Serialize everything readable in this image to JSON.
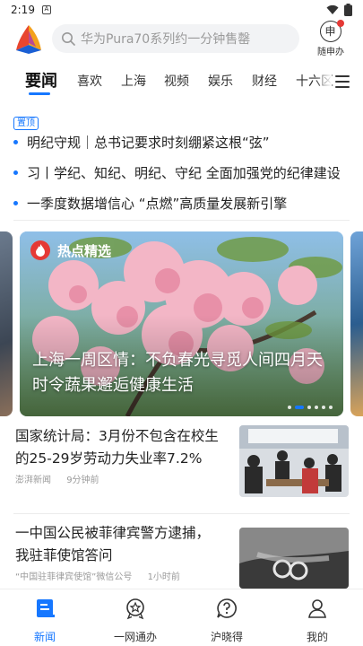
{
  "status_bar": {
    "time": "2:19",
    "sim_label": "A"
  },
  "header": {
    "search_placeholder": "华为Pura70系列约一分钟售罄",
    "suishen_label": "随申办"
  },
  "tabs": [
    {
      "label": "要闻",
      "active": true
    },
    {
      "label": "喜欢"
    },
    {
      "label": "上海"
    },
    {
      "label": "视频"
    },
    {
      "label": "娱乐"
    },
    {
      "label": "财经"
    },
    {
      "label": "十六区"
    }
  ],
  "top_stories": {
    "badge": "置顶",
    "items": [
      "明纪守规｜总书记要求时刻绷紧这根“弦”",
      "习丨学纪、知纪、明纪、守纪 全面加强党的纪律建设",
      "一季度数据增信心 “点燃”高质量发展新引擎"
    ]
  },
  "carousel": {
    "label": "热点精选",
    "title": "上海一周区情：不负春光寻觅人间四月天 时令蔬果邂逅健康生活",
    "dot_count": 6,
    "active_dot": 1
  },
  "news": [
    {
      "title": "国家统计局：3月份不包含在校生的25-29岁劳动力失业率7.2%",
      "source": "澎湃新闻",
      "time": "9分钟前"
    },
    {
      "title": "一中国公民被菲律宾警方逮捕，我驻菲使馆答问",
      "source": "“中国驻菲律宾使馆”微信公号",
      "time": "1小时前"
    }
  ],
  "bottom_nav": [
    {
      "label": "新闻",
      "active": true,
      "icon": "news-icon"
    },
    {
      "label": "一网通办",
      "icon": "star-shield-icon"
    },
    {
      "label": "沪晓得",
      "icon": "question-bubble-icon"
    },
    {
      "label": "我的",
      "icon": "person-icon"
    }
  ],
  "colors": {
    "accent": "#1677ff",
    "badge_red": "#e53935"
  }
}
